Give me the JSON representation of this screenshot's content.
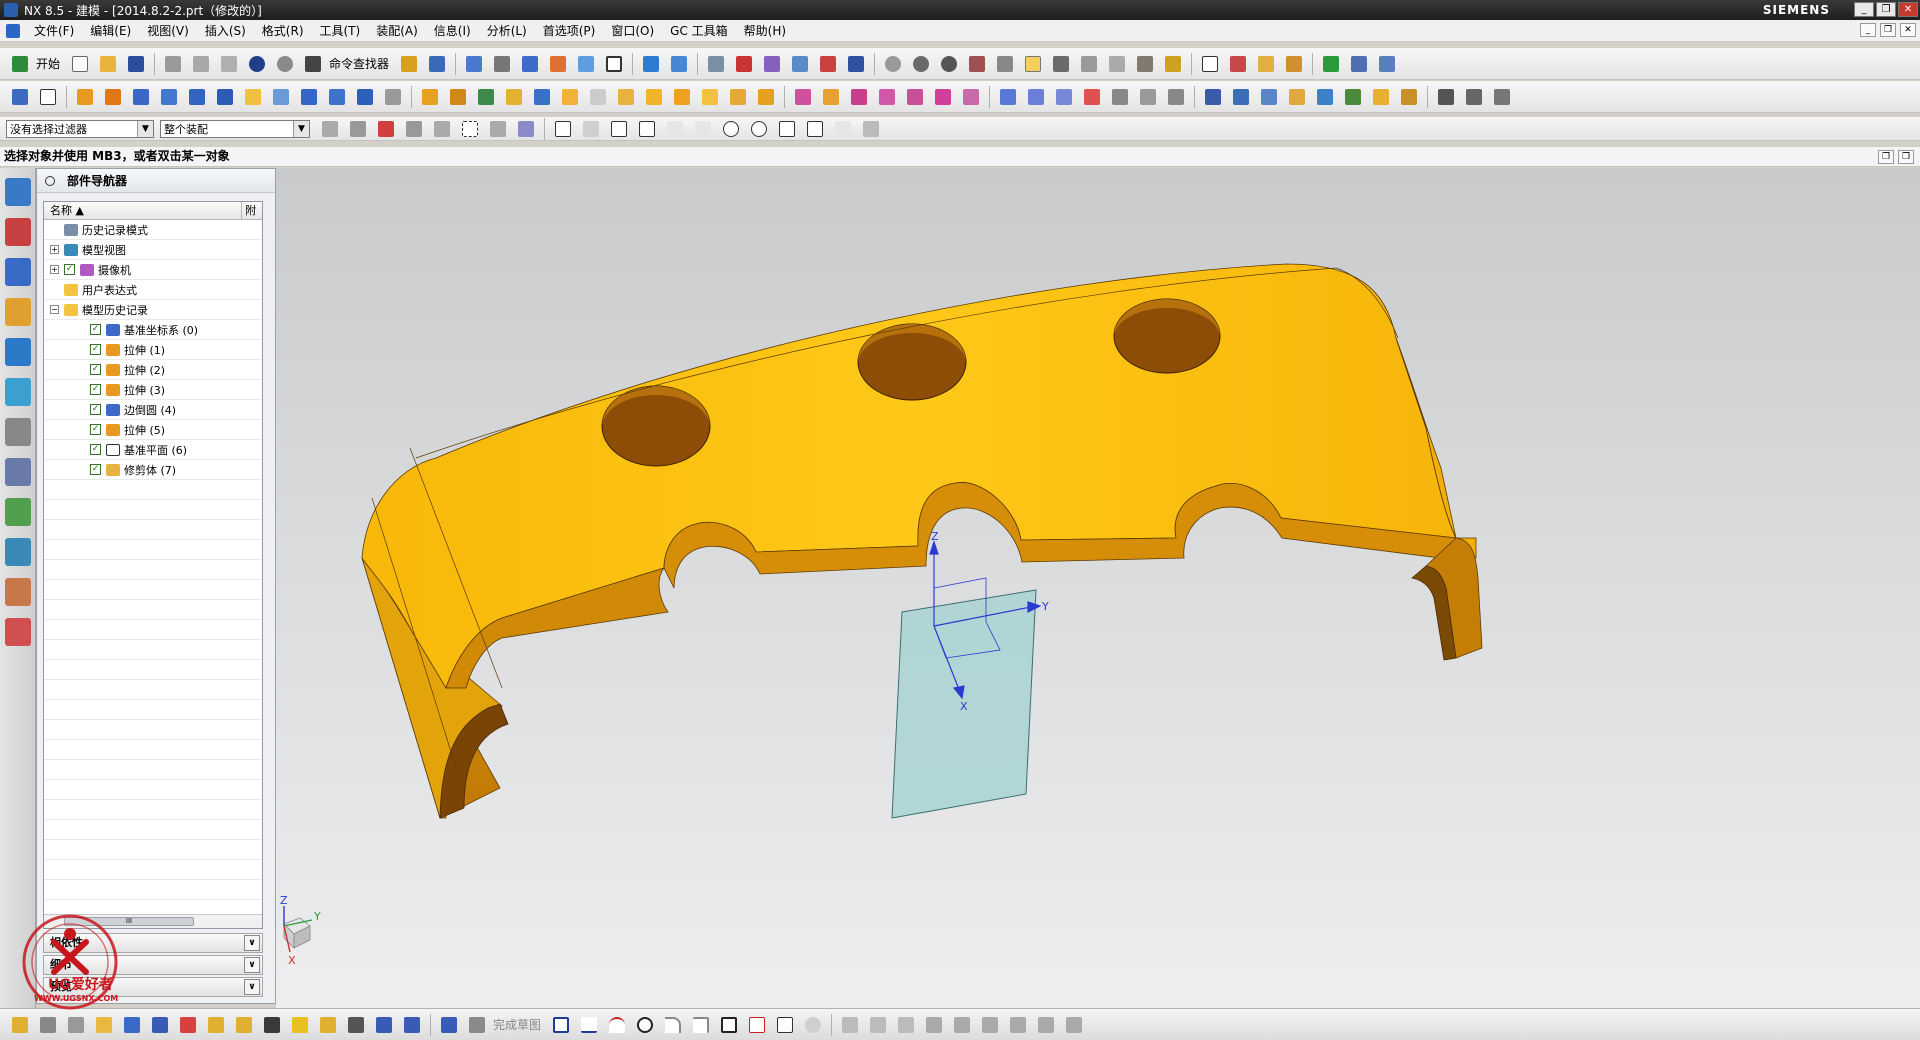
{
  "window": {
    "title": "NX 8.5 - 建模 - [2014.8.2-2.prt（修改的）]",
    "brand": "SIEMENS",
    "min_glyph": "_",
    "restore_glyph": "❐",
    "close_glyph": "✕"
  },
  "menubar": {
    "items": [
      "文件(F)",
      "编辑(E)",
      "视图(V)",
      "插入(S)",
      "格式(R)",
      "工具(T)",
      "装配(A)",
      "信息(I)",
      "分析(L)",
      "首选项(P)",
      "窗口(O)",
      "GC 工具箱",
      "帮助(H)"
    ]
  },
  "toolbar": {
    "start_label": "开始",
    "command_finder_label": "命令查找器"
  },
  "selection_bar": {
    "filter_value": "没有选择过滤器",
    "scope_value": "整个装配"
  },
  "prompt": {
    "text": "选择对象并使用 MB3，或者双击某一对象"
  },
  "navigator": {
    "title": "部件导航器",
    "column_name": "名称",
    "column_attached": "附",
    "rows": [
      {
        "label": "历史记录模式",
        "level": 0,
        "expand": "",
        "checked": false,
        "icon": "clock-icon"
      },
      {
        "label": "模型视图",
        "level": 0,
        "expand": "+",
        "checked": false,
        "icon": "model-views-icon"
      },
      {
        "label": "摄像机",
        "level": 0,
        "expand": "+",
        "checked": true,
        "icon": "camera-icon"
      },
      {
        "label": "用户表达式",
        "level": 0,
        "expand": "",
        "checked": false,
        "icon": "folder-icon"
      },
      {
        "label": "模型历史记录",
        "level": 0,
        "expand": "−",
        "checked": false,
        "icon": "folder-open-icon"
      },
      {
        "label": "基准坐标系 (0)",
        "level": 1,
        "expand": "",
        "checked": true,
        "icon": "datum-csys-icon"
      },
      {
        "label": "拉伸 (1)",
        "level": 1,
        "expand": "",
        "checked": true,
        "icon": "extrude-icon"
      },
      {
        "label": "拉伸 (2)",
        "level": 1,
        "expand": "",
        "checked": true,
        "icon": "extrude-icon"
      },
      {
        "label": "拉伸 (3)",
        "level": 1,
        "expand": "",
        "checked": true,
        "icon": "extrude-icon"
      },
      {
        "label": "边倒圆 (4)",
        "level": 1,
        "expand": "",
        "checked": true,
        "icon": "edge-blend-icon"
      },
      {
        "label": "拉伸 (5)",
        "level": 1,
        "expand": "",
        "checked": true,
        "icon": "extrude-icon"
      },
      {
        "label": "基准平面 (6)",
        "level": 1,
        "expand": "",
        "checked": true,
        "icon": "datum-plane-icon"
      },
      {
        "label": "修剪体 (7)",
        "level": 1,
        "expand": "",
        "checked": true,
        "icon": "trim-body-icon"
      }
    ],
    "scroll_thumb": "III",
    "panels": [
      "相依性",
      "细节",
      "预览"
    ]
  },
  "graphics": {
    "axis_labels": {
      "z": "Z",
      "y": "Y",
      "x": "X"
    },
    "triad_labels": {
      "z": "Z",
      "y": "Y",
      "x": "X"
    },
    "colors": {
      "part": "#f2b40c",
      "part_dark": "#c98608",
      "hole": "#8a4a05",
      "datum_plane": "#9fd1cf"
    }
  },
  "bottom_toolbar": {
    "finish_sketch_label": "完成草图"
  },
  "watermark": {
    "text": "UG爱好者",
    "url": "WWW.UGSNX.COM"
  }
}
